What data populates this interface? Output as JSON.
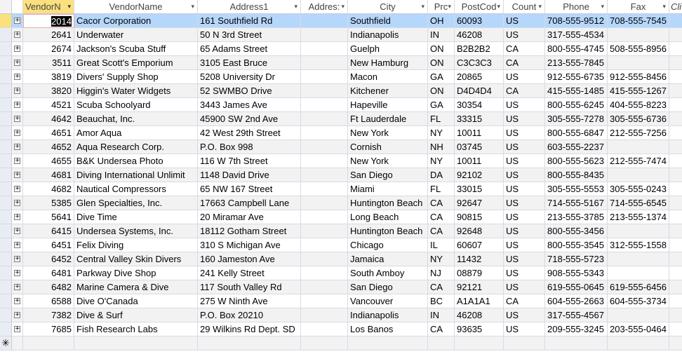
{
  "table": {
    "columns": [
      {
        "key": "id",
        "label": "VendorN",
        "sorted": true
      },
      {
        "key": "name",
        "label": "VendorName"
      },
      {
        "key": "a1",
        "label": "Address1"
      },
      {
        "key": "a2",
        "label": "Addres:"
      },
      {
        "key": "city",
        "label": "City"
      },
      {
        "key": "prov",
        "label": "Prc"
      },
      {
        "key": "post",
        "label": "PostCod"
      },
      {
        "key": "ctry",
        "label": "Count"
      },
      {
        "key": "phone",
        "label": "Phone"
      },
      {
        "key": "fax",
        "label": "Fax"
      },
      {
        "key": "cli",
        "label": "Cli"
      }
    ],
    "expand_glyph": "+",
    "new_record_glyph": "✳",
    "sort_arrow": "▾",
    "rows": [
      {
        "id": "2014",
        "name": "Cacor Corporation",
        "a1": "161 Southfield Rd",
        "a2": "",
        "city": "Southfield",
        "prov": "OH",
        "post": "60093",
        "ctry": "US",
        "phone": "708-555-9512",
        "fax": "708-555-7545"
      },
      {
        "id": "2641",
        "name": "Underwater",
        "a1": "50 N 3rd Street",
        "a2": "",
        "city": "Indianapolis",
        "prov": "IN",
        "post": "46208",
        "ctry": "US",
        "phone": "317-555-4534",
        "fax": ""
      },
      {
        "id": "2674",
        "name": "Jackson's Scuba Stuff",
        "a1": "65 Adams Street",
        "a2": "",
        "city": "Guelph",
        "prov": "ON",
        "post": "B2B2B2",
        "ctry": "CA",
        "phone": "800-555-4745",
        "fax": "508-555-8956"
      },
      {
        "id": "3511",
        "name": "Great Scott's Emporium",
        "a1": "3105 East Bruce",
        "a2": "",
        "city": "New Hamburg",
        "prov": "ON",
        "post": "C3C3C3",
        "ctry": "CA",
        "phone": "213-555-7845",
        "fax": ""
      },
      {
        "id": "3819",
        "name": "Divers'  Supply Shop",
        "a1": "5208 University Dr",
        "a2": "",
        "city": "Macon",
        "prov": "GA",
        "post": "20865",
        "ctry": "US",
        "phone": "912-555-6735",
        "fax": "912-555-8456"
      },
      {
        "id": "3820",
        "name": "Higgin's Water Widgets",
        "a1": "52 SWMBO Drive",
        "a2": "",
        "city": "Kitchener",
        "prov": "ON",
        "post": "D4D4D4",
        "ctry": "CA",
        "phone": "415-555-1485",
        "fax": "415-555-1267"
      },
      {
        "id": "4521",
        "name": "Scuba Schoolyard",
        "a1": "3443 James Ave",
        "a2": "",
        "city": "Hapeville",
        "prov": "GA",
        "post": "30354",
        "ctry": "US",
        "phone": "800-555-6245",
        "fax": "404-555-8223"
      },
      {
        "id": "4642",
        "name": "Beauchat, Inc.",
        "a1": "45900 SW 2nd Ave",
        "a2": "",
        "city": "Ft Lauderdale",
        "prov": "FL",
        "post": "33315",
        "ctry": "US",
        "phone": "305-555-7278",
        "fax": "305-555-6736"
      },
      {
        "id": "4651",
        "name": "Amor Aqua",
        "a1": "42 West 29th Street",
        "a2": "",
        "city": "New York",
        "prov": "NY",
        "post": "10011",
        "ctry": "US",
        "phone": "800-555-6847",
        "fax": "212-555-7256"
      },
      {
        "id": "4652",
        "name": "Aqua Research Corp.",
        "a1": "P.O. Box 998",
        "a2": "",
        "city": "Cornish",
        "prov": "NH",
        "post": "03745",
        "ctry": "US",
        "phone": "603-555-2237",
        "fax": ""
      },
      {
        "id": "4655",
        "name": "B&K Undersea Photo",
        "a1": "116 W 7th Street",
        "a2": "",
        "city": "New York",
        "prov": "NY",
        "post": "10011",
        "ctry": "US",
        "phone": "800-555-5623",
        "fax": "212-555-7474"
      },
      {
        "id": "4681",
        "name": "Diving International Unlimit",
        "a1": "1148 David Drive",
        "a2": "",
        "city": "San Diego",
        "prov": "DA",
        "post": "92102",
        "ctry": "US",
        "phone": "800-555-8435",
        "fax": ""
      },
      {
        "id": "4682",
        "name": "Nautical Compressors",
        "a1": "65 NW 167 Street",
        "a2": "",
        "city": "Miami",
        "prov": "FL",
        "post": "33015",
        "ctry": "US",
        "phone": "305-555-5553",
        "fax": "305-555-0243"
      },
      {
        "id": "5385",
        "name": "Glen Specialties, Inc.",
        "a1": "17663 Campbell Lane",
        "a2": "",
        "city": "Huntington Beach",
        "prov": "CA",
        "post": "92647",
        "ctry": "US",
        "phone": "714-555-5167",
        "fax": "714-555-6545"
      },
      {
        "id": "5641",
        "name": "Dive Time",
        "a1": "20 Miramar Ave",
        "a2": "",
        "city": "Long Beach",
        "prov": "CA",
        "post": "90815",
        "ctry": "US",
        "phone": "213-555-3785",
        "fax": "213-555-1374"
      },
      {
        "id": "6415",
        "name": "Undersea Systems, Inc.",
        "a1": "18112 Gotham Street",
        "a2": "",
        "city": "Huntington Beach",
        "prov": "CA",
        "post": "92648",
        "ctry": "US",
        "phone": "800-555-3456",
        "fax": ""
      },
      {
        "id": "6451",
        "name": "Felix Diving",
        "a1": "310 S Michigan Ave",
        "a2": "",
        "city": "Chicago",
        "prov": "IL",
        "post": "60607",
        "ctry": "US",
        "phone": "800-555-3545",
        "fax": "312-555-1558"
      },
      {
        "id": "6452",
        "name": "Central Valley Skin Divers",
        "a1": "160 Jameston Ave",
        "a2": "",
        "city": "Jamaica",
        "prov": "NY",
        "post": "11432",
        "ctry": "US",
        "phone": "718-555-5723",
        "fax": ""
      },
      {
        "id": "6481",
        "name": "Parkway Dive Shop",
        "a1": "241 Kelly Street",
        "a2": "",
        "city": "South Amboy",
        "prov": "NJ",
        "post": "08879",
        "ctry": "US",
        "phone": "908-555-5343",
        "fax": ""
      },
      {
        "id": "6482",
        "name": "Marine Camera & Dive",
        "a1": "117 South Valley Rd",
        "a2": "",
        "city": "San Diego",
        "prov": "CA",
        "post": "92121",
        "ctry": "US",
        "phone": "619-555-0645",
        "fax": "619-555-6456"
      },
      {
        "id": "6588",
        "name": "Dive O'Canada",
        "a1": "275 W Ninth Ave",
        "a2": "",
        "city": "Vancouver",
        "prov": "BC",
        "post": "A1A1A1",
        "ctry": "CA",
        "phone": "604-555-2663",
        "fax": "604-555-3734"
      },
      {
        "id": "7382",
        "name": "Dive & Surf",
        "a1": "P.O. Box 20210",
        "a2": "",
        "city": "Indianapolis",
        "prov": "IN",
        "post": "46208",
        "ctry": "US",
        "phone": "317-555-4567",
        "fax": ""
      },
      {
        "id": "7685",
        "name": "Fish Research Labs",
        "a1": "29 Wilkins Rd Dept. SD",
        "a2": "",
        "city": "Los Banos",
        "prov": "CA",
        "post": "93635",
        "ctry": "US",
        "phone": "209-555-3245",
        "fax": "203-555-0464"
      }
    ],
    "selected_row_index": 0
  }
}
